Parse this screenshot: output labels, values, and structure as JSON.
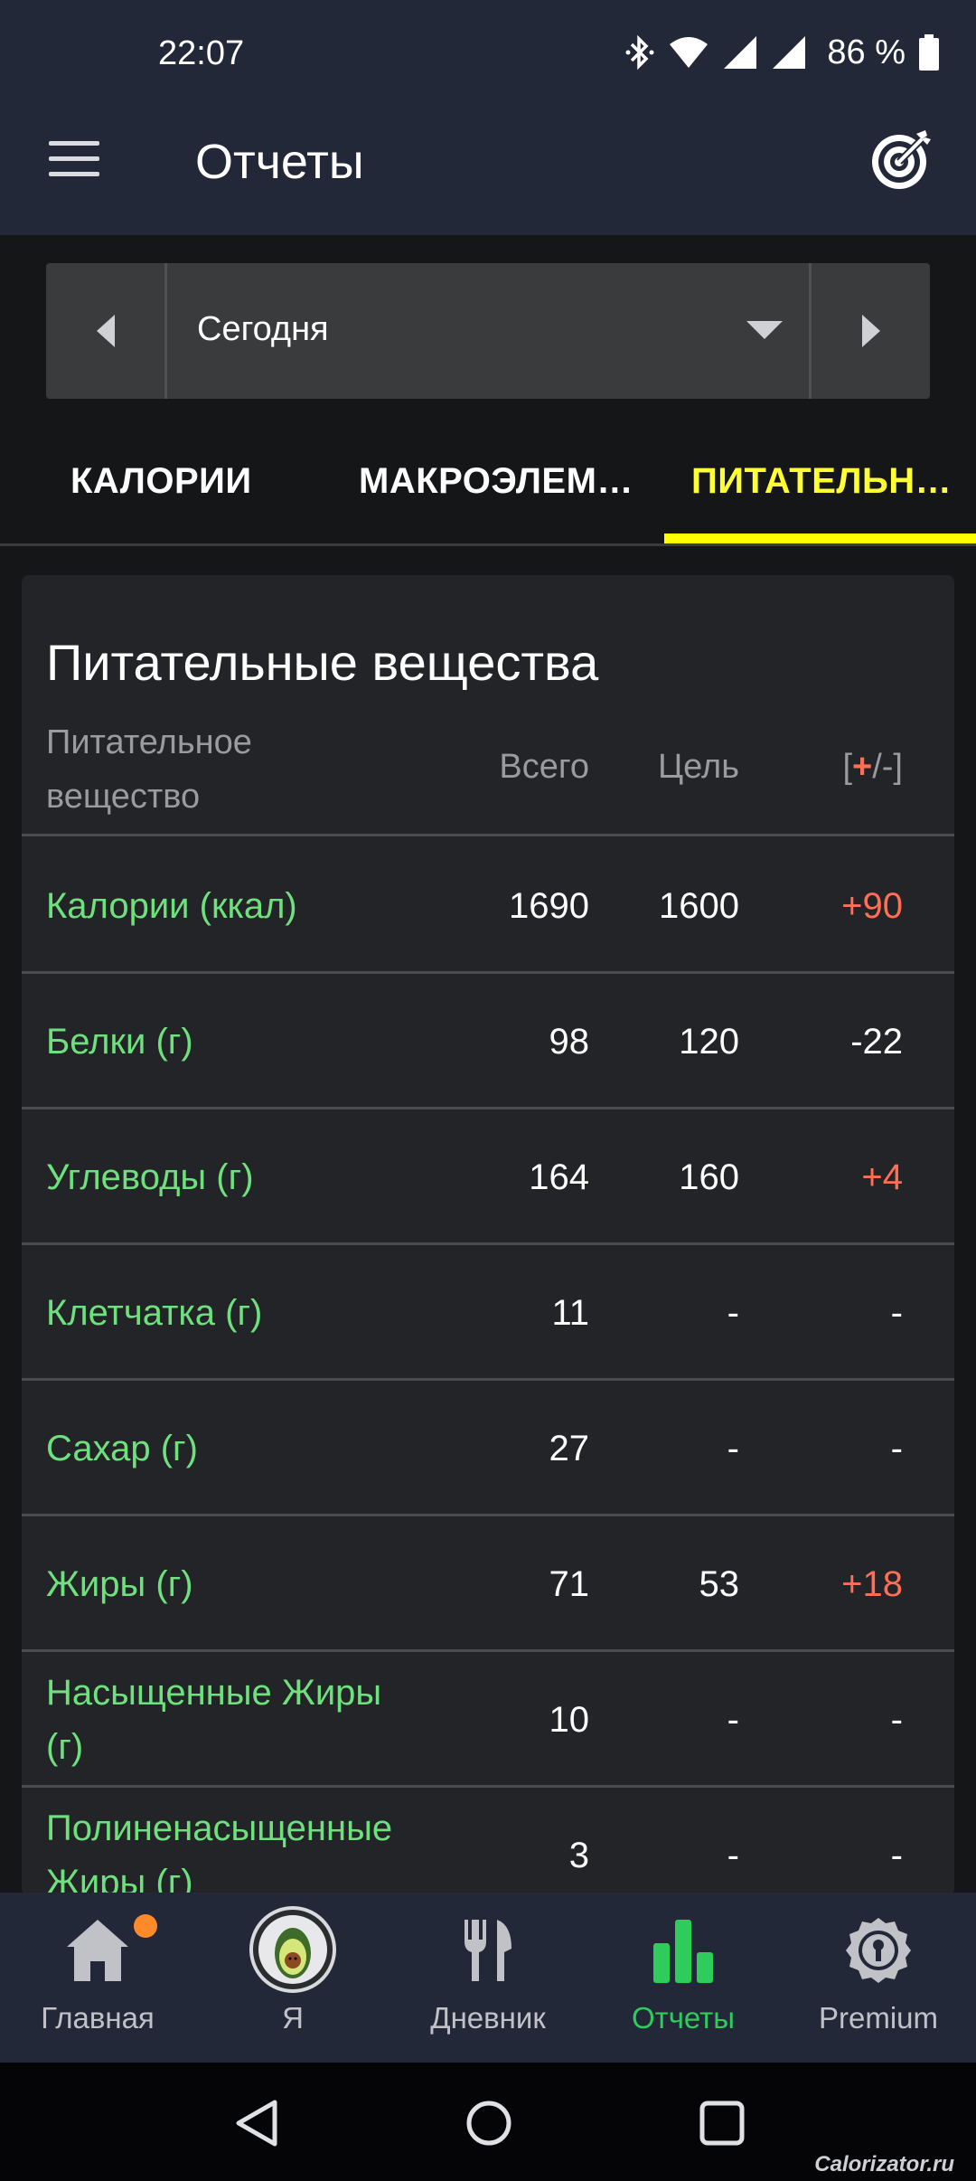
{
  "status_bar": {
    "time": "22:07",
    "battery": "86 %",
    "icons": [
      "bluetooth-icon",
      "wifi-icon",
      "signal-icon",
      "signal-icon",
      "battery-icon"
    ]
  },
  "app_bar": {
    "title": "Отчеты",
    "left_icon": "menu-icon",
    "right_icon": "target-icon"
  },
  "date_selector": {
    "value": "Сегодня"
  },
  "tabs": [
    {
      "label": "КАЛОРИИ",
      "active": false
    },
    {
      "label": "МАКРОЭЛЕМ…",
      "active": false
    },
    {
      "label": "ПИТАТЕЛЬН…",
      "active": true
    }
  ],
  "nutrients_card": {
    "title": "Питательные вещества",
    "headers": {
      "nutrient": "Питательное вещество",
      "total": "Всего",
      "goal": "Цель",
      "diff_open": "[",
      "diff_plus": "+",
      "diff_close": "/-]"
    },
    "rows": [
      {
        "name": "Калории (ккал)",
        "total": "1690",
        "goal": "1600",
        "diff": "+90"
      },
      {
        "name": "Белки (г)",
        "total": "98",
        "goal": "120",
        "diff": "-22"
      },
      {
        "name": "Углеводы (г)",
        "total": "164",
        "goal": "160",
        "diff": "+4"
      },
      {
        "name": "Клетчатка (г)",
        "total": "11",
        "goal": "-",
        "diff": "-"
      },
      {
        "name": "Сахар (г)",
        "total": "27",
        "goal": "-",
        "diff": "-"
      },
      {
        "name": "Жиры (г)",
        "total": "71",
        "goal": "53",
        "diff": "+18"
      },
      {
        "name": "Насыщенные Жиры (г)",
        "total": "10",
        "goal": "-",
        "diff": "-"
      },
      {
        "name": "Полиненасыщенные Жиры (г)",
        "total": "3",
        "goal": "-",
        "diff": "-"
      }
    ]
  },
  "bottom_nav": [
    {
      "label": "Главная",
      "icon": "home-icon",
      "badge": true
    },
    {
      "label": "Я",
      "icon": "avocado-avatar-icon"
    },
    {
      "label": "Дневник",
      "icon": "fork-knife-icon"
    },
    {
      "label": "Отчеты",
      "icon": "bar-chart-icon",
      "active": true
    },
    {
      "label": "Premium",
      "icon": "premium-badge-icon"
    }
  ],
  "colors": {
    "app_bar": "#232838",
    "accent_yellow": "#ffff00",
    "nutrient_green": "#6fe07e",
    "over_red": "#ff6e55",
    "active_nav_green": "#2ecc5b"
  },
  "watermark": "Calorizator.ru"
}
